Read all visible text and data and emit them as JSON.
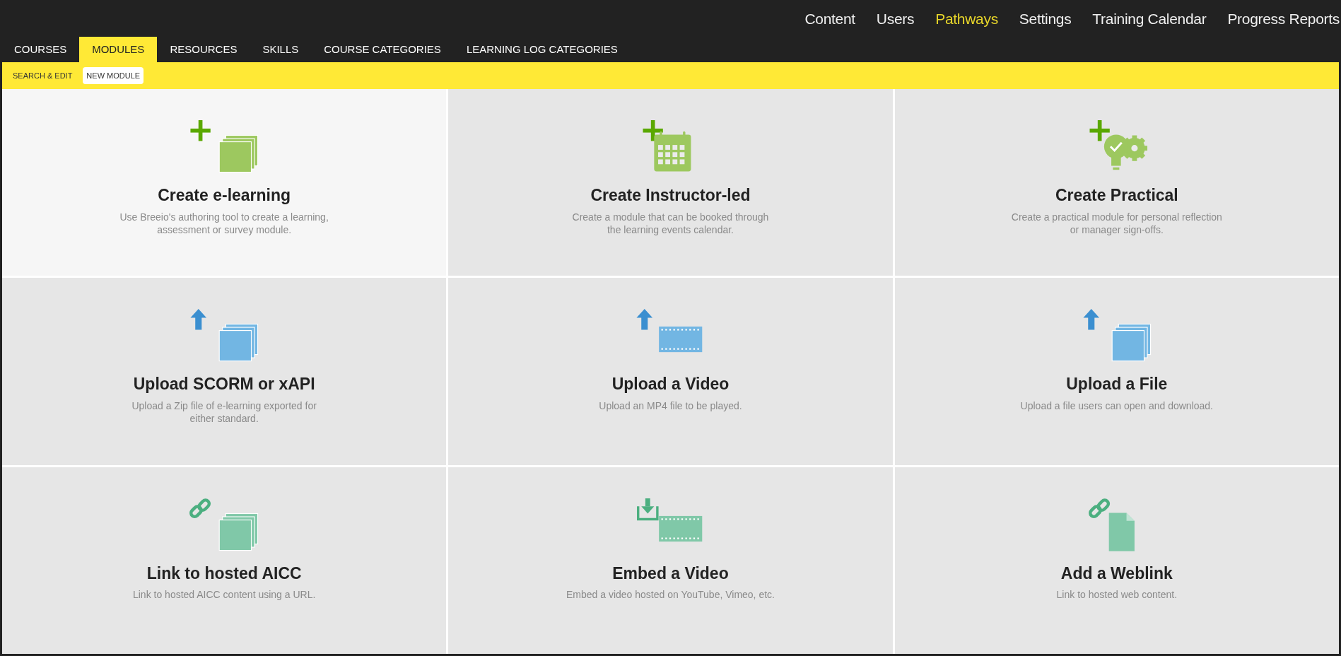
{
  "top_nav": [
    {
      "label": "Content",
      "selected": false
    },
    {
      "label": "Users",
      "selected": false
    },
    {
      "label": "Pathways",
      "selected": true
    },
    {
      "label": "Settings",
      "selected": false
    },
    {
      "label": "Training Calendar",
      "selected": false
    },
    {
      "label": "Progress Reports",
      "selected": false
    }
  ],
  "tabs": [
    {
      "label": "COURSES",
      "selected": false
    },
    {
      "label": "MODULES",
      "selected": true
    },
    {
      "label": "RESOURCES",
      "selected": false
    },
    {
      "label": "SKILLS",
      "selected": false
    },
    {
      "label": "COURSE CATEGORIES",
      "selected": false
    },
    {
      "label": "LEARNING LOG CATEGORIES",
      "selected": false
    }
  ],
  "sub_tabs": [
    {
      "label": "SEARCH & EDIT",
      "selected": false
    },
    {
      "label": "NEW MODULE",
      "selected": true
    }
  ],
  "cards": [
    {
      "kind": "elearning",
      "title": "Create e-learning",
      "description": "Use Breeio's authoring tool to create a learning, assessment or survey module.",
      "selected": true
    },
    {
      "kind": "instructor",
      "title": "Create Instructor-led",
      "description": "Create a module that can be booked through the learning events calendar.",
      "selected": false
    },
    {
      "kind": "practical",
      "title": "Create Practical",
      "description": "Create a practical module for personal reflection or manager sign-offs.",
      "selected": false
    },
    {
      "kind": "scorm",
      "title": "Upload SCORM or xAPI",
      "description": "Upload a Zip file of e-learning exported for either standard.",
      "selected": false
    },
    {
      "kind": "video",
      "title": "Upload a Video",
      "description": "Upload an MP4 file to be played.",
      "selected": false
    },
    {
      "kind": "file",
      "title": "Upload a File",
      "description": "Upload a file users can open and download.",
      "selected": false
    },
    {
      "kind": "aicc",
      "title": "Link to hosted AICC",
      "description": "Link to hosted AICC content using a URL.",
      "selected": false
    },
    {
      "kind": "embed",
      "title": "Embed a Video",
      "description": "Embed a video hosted on YouTube, Vimeo, etc.",
      "selected": false
    },
    {
      "kind": "weblink",
      "title": "Add a Weblink",
      "description": "Link to hosted web content.",
      "selected": false
    }
  ]
}
